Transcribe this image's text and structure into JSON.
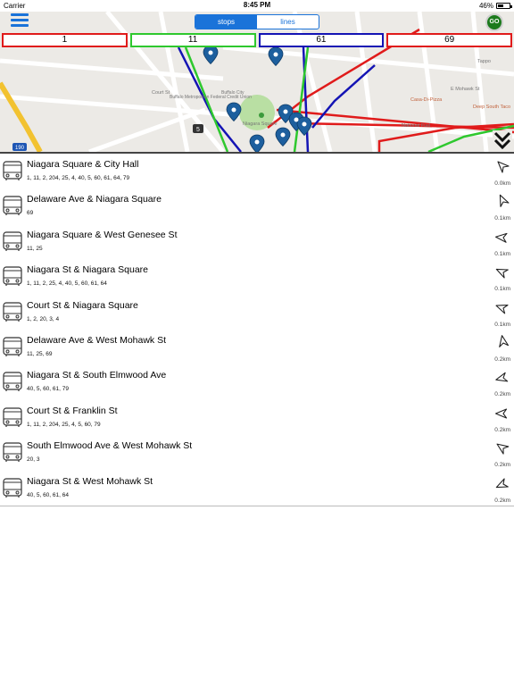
{
  "status_bar": {
    "carrier": "Carrier",
    "time": "8:45 PM",
    "battery": "46%",
    "battery_level": 0.46
  },
  "nav": {
    "segments": [
      {
        "label": "stops",
        "active": true
      },
      {
        "label": "lines",
        "active": false
      }
    ],
    "go_label": "GO"
  },
  "line_tabs": [
    {
      "label": "1",
      "color": "#e01b1b"
    },
    {
      "label": "11",
      "color": "#2ec82e"
    },
    {
      "label": "61",
      "color": "#1414b4"
    },
    {
      "label": "69",
      "color": "#e01b1b"
    }
  ],
  "map": {
    "labels": {
      "court_st": "Court St",
      "niagara_square": "Niagara Square",
      "buffalo_metro": "Buffalo Metropolitan Federal Credit Union",
      "buffalo_city": "Buffalo City",
      "casa_di_pizza": "Casa-Di-Pizza",
      "national_fuel": "National Fuel",
      "mohawk_st": "E Mohawk St",
      "tappo": "Tappo",
      "deep_south": "Deep South Taco",
      "route_190": "190",
      "route_5": "5"
    }
  },
  "stops": [
    {
      "name": "Niagara Square & City Hall",
      "lines": "1, 11, 2, 204, 25, 4, 40, 5, 60, 61, 64, 79",
      "distance": "0.0km",
      "heading": 0
    },
    {
      "name": "Delaware Ave & Niagara Square",
      "lines": "69",
      "distance": "0.1km",
      "heading": 20
    },
    {
      "name": "Niagara Square & West Genesee St",
      "lines": "11, 25",
      "distance": "0.1km",
      "heading": -40
    },
    {
      "name": "Niagara St & Niagara Square",
      "lines": "1, 11, 2, 25, 4, 40, 5, 60, 61, 64",
      "distance": "0.1km",
      "heading": -20
    },
    {
      "name": "Court St & Niagara Square",
      "lines": "1, 2, 20, 3, 4",
      "distance": "0.1km",
      "heading": -25
    },
    {
      "name": "Delaware Ave & West Mohawk St",
      "lines": "11, 25, 69",
      "distance": "0.2km",
      "heading": 35
    },
    {
      "name": "Niagara St & South Elmwood Ave",
      "lines": "40, 5, 60, 61, 79",
      "distance": "0.2km",
      "heading": -60
    },
    {
      "name": "Court St & Franklin St",
      "lines": "1, 11, 2, 204, 25, 4, 5, 60, 79",
      "distance": "0.2km",
      "heading": -45
    },
    {
      "name": "South Elmwood Ave & West Mohawk St",
      "lines": "20, 3",
      "distance": "0.2km",
      "heading": -10
    },
    {
      "name": "Niagara St & West Mohawk St",
      "lines": "40, 5, 60, 61, 64",
      "distance": "0.2km",
      "heading": -70
    }
  ]
}
